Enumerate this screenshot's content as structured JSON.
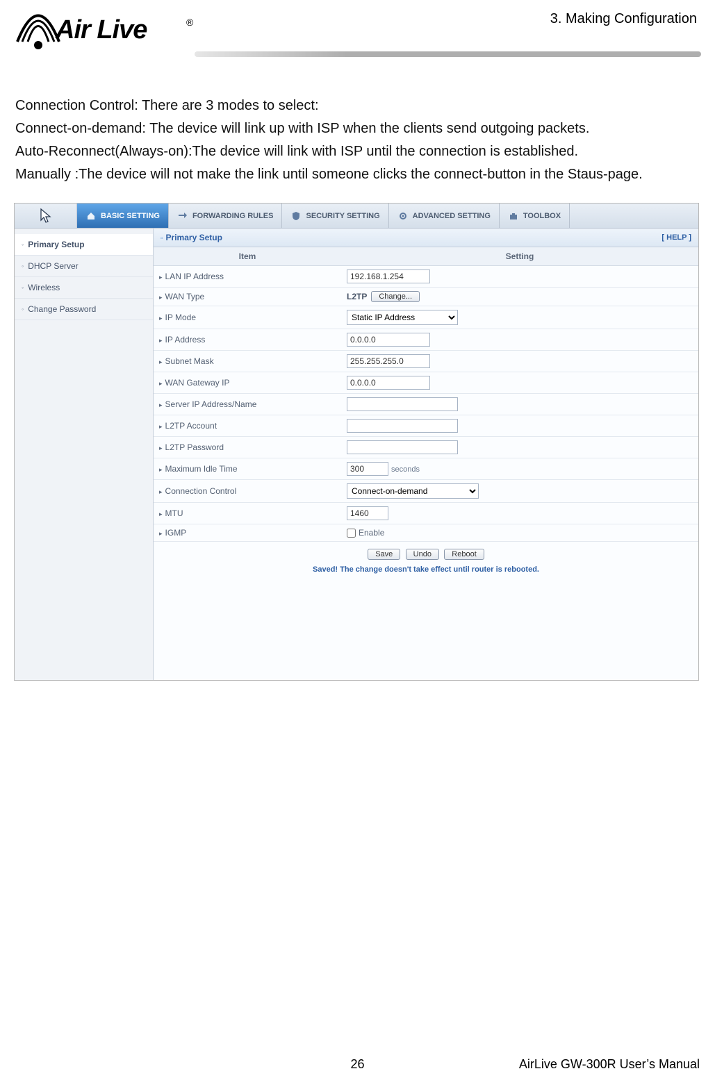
{
  "header": {
    "chapter": "3. Making Configuration",
    "logo_text": "Air Live",
    "logo_reg": "®"
  },
  "body_text": "Connection Control: There are 3 modes to select:\nConnect-on-demand: The device will link up with ISP when the clients send outgoing packets.\nAuto-Reconnect(Always-on):The device will link with ISP until the connection is established.\nManually :The device will not make the link until someone clicks the connect-button in the Staus-page.",
  "ui": {
    "tabs": {
      "basic": "BASIC SETTING",
      "forwarding": "FORWARDING RULES",
      "security": "SECURITY SETTING",
      "advanced": "ADVANCED SETTING",
      "toolbox": "TOOLBOX"
    },
    "sidebar": {
      "primary": "Primary Setup",
      "dhcp": "DHCP Server",
      "wireless": "Wireless",
      "changepw": "Change Password"
    },
    "panel": {
      "title": "Primary Setup",
      "help": "[ HELP ]",
      "col_item": "Item",
      "col_setting": "Setting"
    },
    "rows": {
      "lan_ip_label": "LAN IP Address",
      "lan_ip_value": "192.168.1.254",
      "wan_type_label": "WAN Type",
      "wan_type_value": "L2TP",
      "change_btn": "Change...",
      "ip_mode_label": "IP Mode",
      "ip_mode_value": "Static IP Address",
      "ip_addr_label": "IP Address",
      "ip_addr_value": "0.0.0.0",
      "subnet_label": "Subnet Mask",
      "subnet_value": "255.255.255.0",
      "wan_gw_label": "WAN Gateway IP",
      "wan_gw_value": "0.0.0.0",
      "server_ip_label": "Server IP Address/Name",
      "server_ip_value": "",
      "l2tp_acc_label": "L2TP Account",
      "l2tp_acc_value": "",
      "l2tp_pw_label": "L2TP Password",
      "l2tp_pw_value": "",
      "idle_label": "Maximum Idle Time",
      "idle_value": "300",
      "idle_unit": "seconds",
      "conn_ctrl_label": "Connection Control",
      "conn_ctrl_value": "Connect-on-demand",
      "mtu_label": "MTU",
      "mtu_value": "1460",
      "igmp_label": "IGMP",
      "igmp_enable": "Enable"
    },
    "actions": {
      "save": "Save",
      "undo": "Undo",
      "reboot": "Reboot",
      "saved_note": "Saved! The change doesn't take effect until router is rebooted."
    }
  },
  "footer": {
    "page_num": "26",
    "manual": "AirLive GW-300R User’s Manual"
  }
}
